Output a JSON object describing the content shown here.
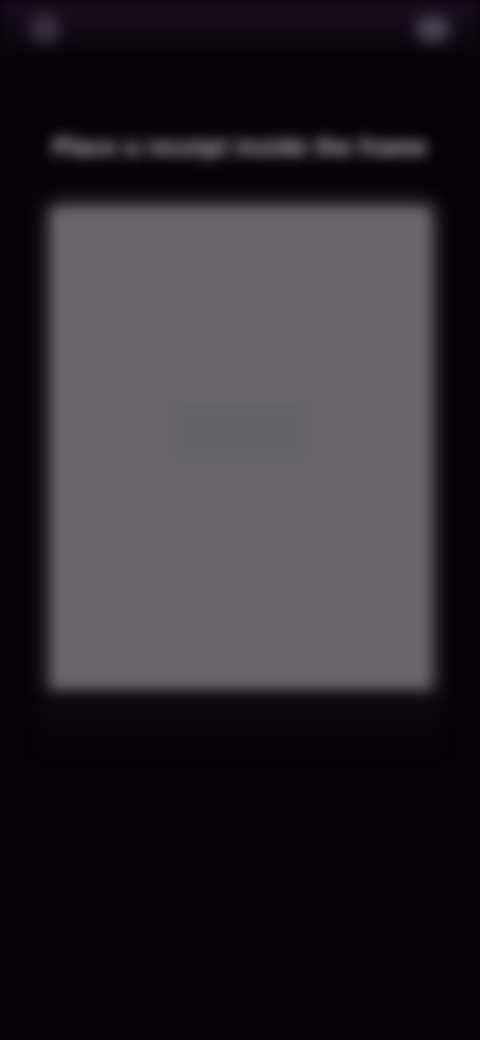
{
  "status_bar": {
    "time": "",
    "right_text": ""
  },
  "prompt": {
    "text": "Place a receipt inside the frame"
  },
  "camera": {
    "state": "viewfinder"
  },
  "colors": {
    "background": "#070208",
    "frame": "#6a666c",
    "prompt_text": "#d9d4dc"
  }
}
